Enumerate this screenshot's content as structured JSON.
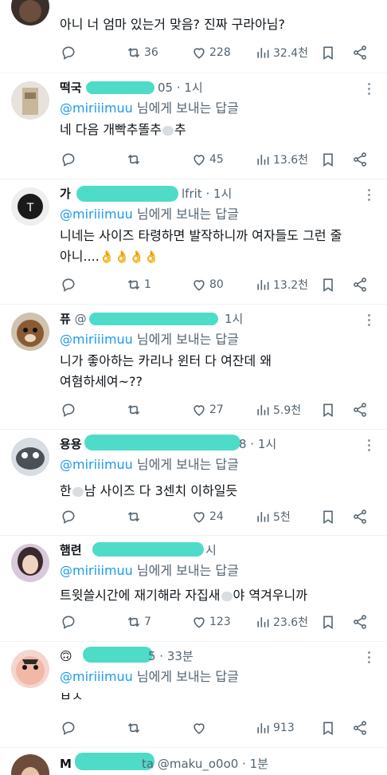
{
  "tweets": [
    {
      "name": "",
      "handle": "",
      "time": "",
      "reply_prefix": "",
      "reply_mention": "",
      "reply_suffix": "",
      "text": "아니 너 엄마 있는거 맞음? 진짜 구라아님?",
      "reply_count": "",
      "retweets": "36",
      "likes": "228",
      "views": "32.4천"
    },
    {
      "name": "떡국",
      "handle": "",
      "time": "05 · 1시",
      "reply_prefix": "",
      "reply_mention": "@miriiimuu",
      "reply_suffix": " 님에게 보내는 답글",
      "text": "네 다음 개빡추똘추",
      "text_tail": "추",
      "reply_count": "",
      "retweets": "",
      "likes": "45",
      "views": "13.6천"
    },
    {
      "name": "가",
      "handle": "lfrit",
      "time": " · 1시",
      "reply_prefix": "",
      "reply_mention": "@miriiimuu",
      "reply_suffix": " 님에게 보내는 답글",
      "text": "니네는 사이즈 타령하면 발작하니까 여자들도 그런 줄\n아니....",
      "reply_count": "",
      "retweets": "1",
      "likes": "80",
      "views": "13.2천"
    },
    {
      "name": "퓨",
      "handle": "@",
      "time": "1시",
      "reply_prefix": "",
      "reply_mention": "@miriiimuu",
      "reply_suffix": " 님에게 보내는 답글",
      "text": "니가 좋아하는 카리나 윈터 다 여잔데 왜\n여혐하세여~??",
      "reply_count": "",
      "retweets": "",
      "likes": "27",
      "views": "5.9천"
    },
    {
      "name": "용용",
      "handle": "",
      "time": "8 · 1시",
      "reply_prefix": "",
      "reply_mention": "@miriiimuu",
      "reply_suffix": " 님에게 보내는 답글",
      "text_head": "한",
      "text": "남 사이즈 다 3센치 이하일듯",
      "reply_count": "",
      "retweets": "",
      "likes": "24",
      "views": "5천"
    },
    {
      "name": "햄련",
      "handle": "",
      "time": "시",
      "reply_prefix": "",
      "reply_mention": "@miriiimuu",
      "reply_suffix": " 님에게 보내는 답글",
      "text": "트윗쓸시간에 재기해라 자집새",
      "text_tail": "야 역겨우니까",
      "reply_count": "",
      "retweets": "7",
      "likes": "123",
      "views": "23.6천"
    },
    {
      "name": "",
      "handle": "",
      "time": "5 · 33분",
      "reply_prefix": "",
      "reply_mention": "@miriiimuu",
      "reply_suffix": " 님에게 보내는 답글",
      "text": "ㅂㅅ",
      "reply_count": "",
      "retweets": "",
      "likes": "",
      "views": "913"
    },
    {
      "name": "M",
      "handle": "ta @maku_o0o0",
      "time": " · 1분",
      "reply_prefix": "",
      "reply_mention": "",
      "reply_suffix": "",
      "text": "",
      "reply_count": "",
      "retweets": "",
      "likes": "",
      "views": ""
    }
  ],
  "icons": {
    "reply": "speech-bubble-icon",
    "retweet": "retweet-arrows-icon",
    "like": "heart-icon",
    "views": "bar-chart-icon",
    "bookmark": "bookmark-icon",
    "share": "share-icon"
  },
  "colors": {
    "mention": "#1d9bf0",
    "secondary_text": "#536471",
    "redaction": "#3fd9c4"
  }
}
